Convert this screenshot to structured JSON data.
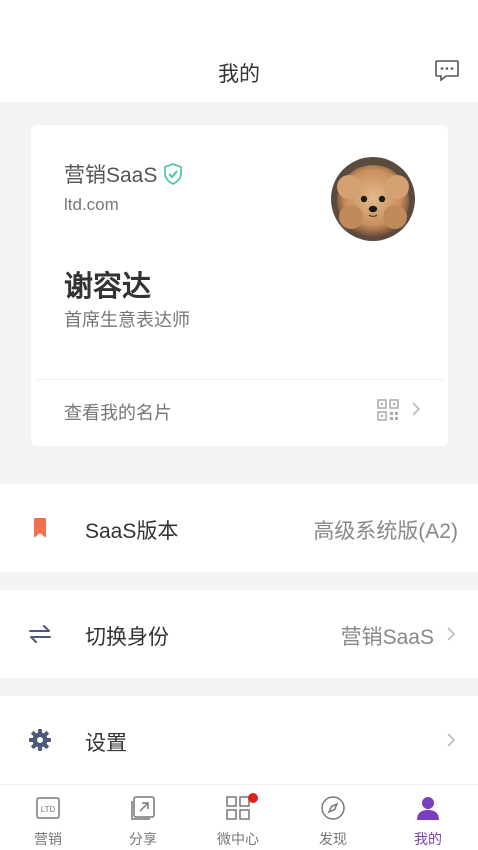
{
  "header": {
    "title": "我的"
  },
  "card": {
    "company": "营销SaaS",
    "domain": "ltd.com",
    "name": "谢容达",
    "title": "首席生意表达师",
    "link_label": "查看我的名片"
  },
  "rows": [
    {
      "label": "SaaS版本",
      "value": "高级系统版(A2)"
    },
    {
      "label": "切换身份",
      "value": "营销SaaS"
    },
    {
      "label": "设置",
      "value": ""
    }
  ],
  "tabs": [
    {
      "label": "营销",
      "icon": "ltd-icon"
    },
    {
      "label": "分享",
      "icon": "share-icon"
    },
    {
      "label": "微中心",
      "icon": "grid-icon"
    },
    {
      "label": "发现",
      "icon": "compass-icon"
    },
    {
      "label": "我的",
      "icon": "user-icon"
    }
  ],
  "colors": {
    "accent": "#7a3fbe",
    "bookmark": "#f07050",
    "verified": "#3cc4a0",
    "badge": "#e02020"
  }
}
